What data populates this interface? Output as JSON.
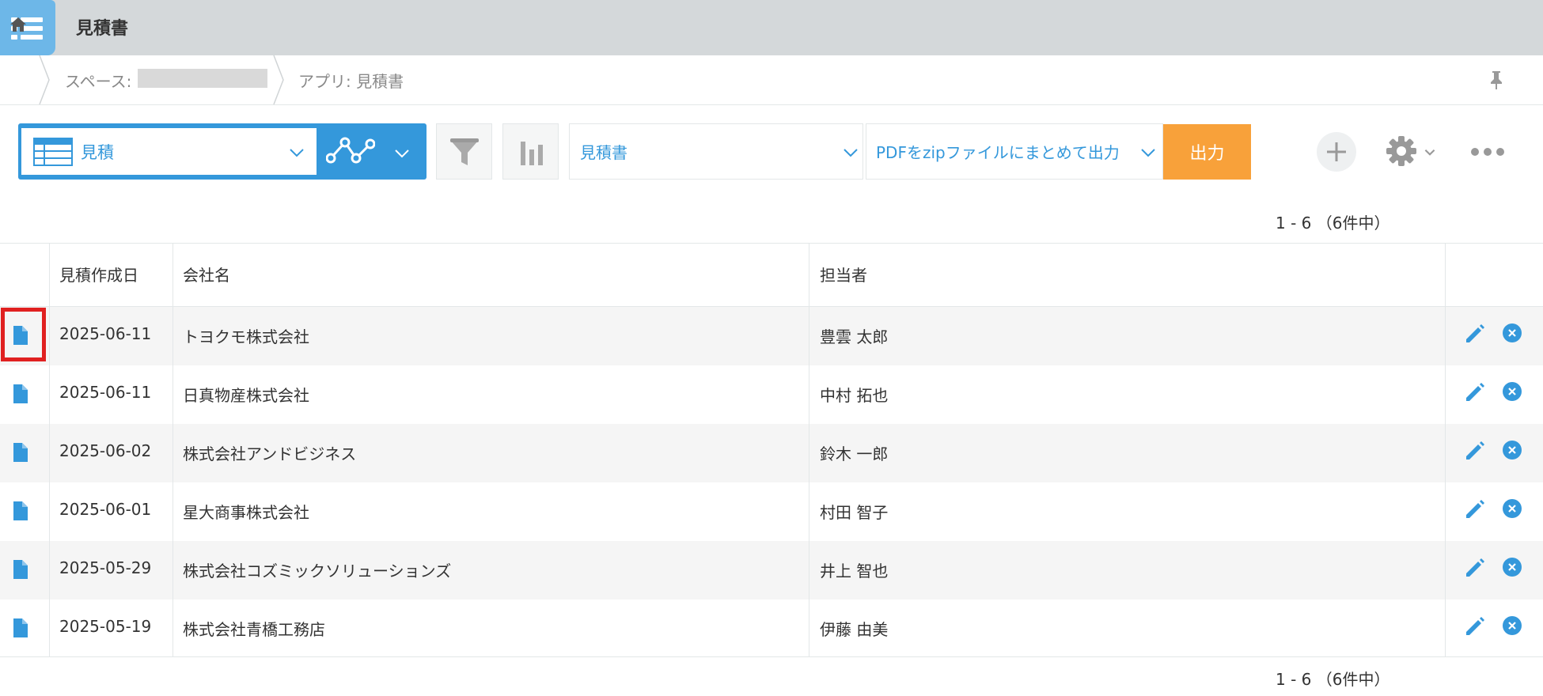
{
  "app": {
    "title": "見積書"
  },
  "breadcrumb": {
    "space_label": "スペース:",
    "app_label": "アプリ: 見積書"
  },
  "toolbar": {
    "view_label": "見積",
    "print_template": "見積書",
    "print_mode": "PDFをzipファイルにまとめて出力",
    "output_button": "出力"
  },
  "pagination": {
    "top": "1 - 6 （6件中）",
    "bottom": "1 - 6 （6件中）"
  },
  "table": {
    "columns": [
      "見積作成日",
      "会社名",
      "担当者"
    ],
    "rows": [
      {
        "date": "2025-06-11",
        "company": "トヨクモ株式会社",
        "person": "豊雲 太郎"
      },
      {
        "date": "2025-06-11",
        "company": "日真物産株式会社",
        "person": "中村 拓也"
      },
      {
        "date": "2025-06-02",
        "company": "株式会社アンドビジネス",
        "person": "鈴木 一郎"
      },
      {
        "date": "2025-06-01",
        "company": "星大商事株式会社",
        "person": "村田 智子"
      },
      {
        "date": "2025-05-29",
        "company": "株式会社コズミックソリューションズ",
        "person": "井上 智也"
      },
      {
        "date": "2025-05-19",
        "company": "株式会社青橋工務店",
        "person": "伊藤 由美"
      }
    ]
  },
  "colors": {
    "accent": "#3498db",
    "output": "#f8a13a",
    "highlight": "#e02020",
    "topbar": "#d4d8da"
  }
}
